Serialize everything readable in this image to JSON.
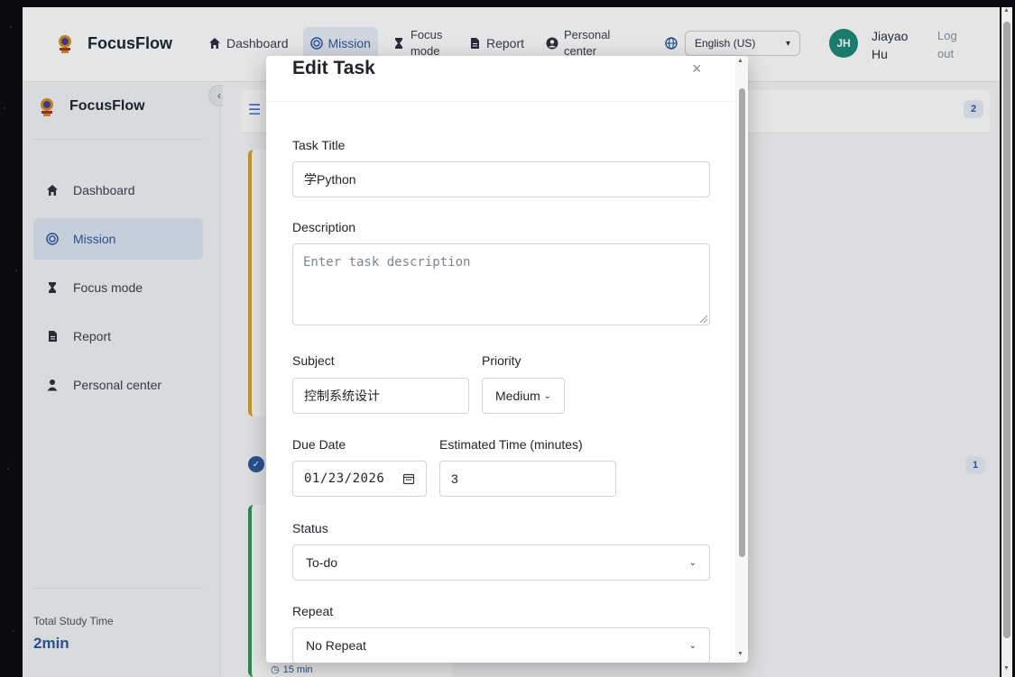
{
  "header": {
    "brand": "FocusFlow",
    "nav": [
      {
        "label": "Dashboard",
        "icon": "home-icon"
      },
      {
        "label": "Mission",
        "icon": "target-icon"
      },
      {
        "label": "Focus mode",
        "icon": "hourglass-icon"
      },
      {
        "label": "Report",
        "icon": "document-icon"
      },
      {
        "label": "Personal center",
        "icon": "user-circle-icon"
      }
    ],
    "language": "English (US)",
    "avatar_initials": "JH",
    "user_name": "Jiayao Hu",
    "logout": "Log out"
  },
  "sidebar": {
    "brand": "FocusFlow",
    "items": [
      {
        "label": "Dashboard",
        "icon": "home-icon"
      },
      {
        "label": "Mission",
        "icon": "target-icon"
      },
      {
        "label": "Focus mode",
        "icon": "hourglass-icon"
      },
      {
        "label": "Report",
        "icon": "document-icon"
      },
      {
        "label": "Personal center",
        "icon": "person-icon"
      }
    ],
    "study_label": "Total Study Time",
    "study_value": "2min"
  },
  "main": {
    "todo_count": "2",
    "done_count": "1",
    "card_time": "15 min"
  },
  "modal": {
    "title": "Edit Task",
    "close": "×",
    "task_title_label": "Task Title",
    "task_title_value": "学Python",
    "description_label": "Description",
    "description_placeholder": "Enter task description",
    "subject_label": "Subject",
    "subject_value": "控制系统设计",
    "priority_label": "Priority",
    "priority_value": "Medium",
    "due_label": "Due Date",
    "due_value": "01/23/2026",
    "est_label": "Estimated Time (minutes)",
    "est_value": "3",
    "status_label": "Status",
    "status_value": "To-do",
    "repeat_label": "Repeat",
    "repeat_value": "No Repeat"
  },
  "colors": {
    "accent": "#2f5aa0",
    "avatar": "#1f8a7a",
    "todo_border": "#e0a21a",
    "done_border": "#2e9b5b"
  }
}
